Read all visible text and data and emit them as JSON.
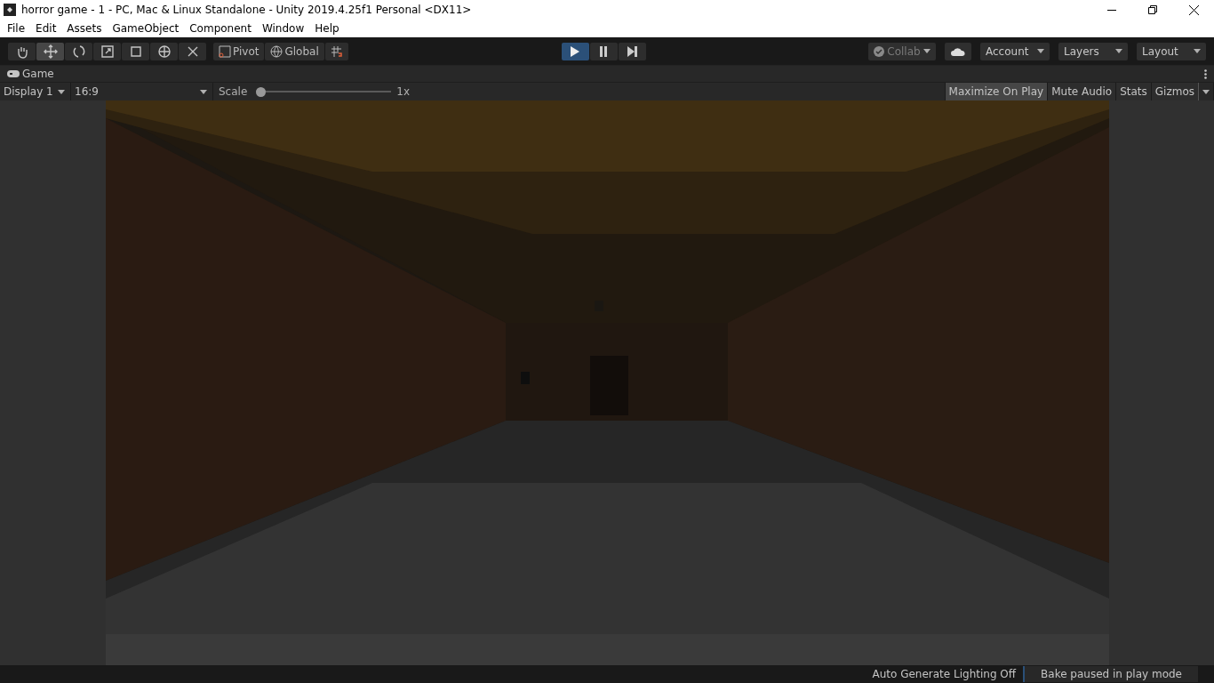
{
  "window": {
    "title": "horror game - 1 - PC, Mac & Linux Standalone - Unity 2019.4.25f1 Personal <DX11>"
  },
  "menu": [
    "File",
    "Edit",
    "Assets",
    "GameObject",
    "Component",
    "Window",
    "Help"
  ],
  "tools": [
    {
      "kind": "hand",
      "selected": false
    },
    {
      "kind": "move",
      "selected": true
    },
    {
      "kind": "rotate",
      "selected": false
    },
    {
      "kind": "scale",
      "selected": false
    },
    {
      "kind": "rect",
      "selected": false
    },
    {
      "kind": "transform",
      "selected": false
    },
    {
      "kind": "custom",
      "selected": false
    }
  ],
  "handles": [
    {
      "kind": "pivot",
      "label": "Pivot"
    },
    {
      "kind": "global",
      "label": "Global"
    },
    {
      "kind": "snap"
    }
  ],
  "playback": [
    {
      "kind": "play",
      "on": true
    },
    {
      "kind": "pause",
      "on": false
    },
    {
      "kind": "step",
      "on": false
    }
  ],
  "right_toolbar": {
    "collab": "Collab",
    "account": "Account",
    "layers": "Layers",
    "layout": "Layout"
  },
  "game_tab": {
    "label": "Game"
  },
  "game_toolbar": {
    "display": "Display 1",
    "aspect": "16:9",
    "scale_label": "Scale",
    "scale": {
      "level": 0.0
    },
    "scale_value": "1x",
    "toggles": [
      {
        "label": "Maximize On Play",
        "on": true
      },
      {
        "label": "Mute Audio",
        "on": false
      },
      {
        "label": "Stats",
        "on": false
      },
      {
        "label": "Gizmos",
        "on": false
      }
    ]
  },
  "status_bar": {
    "lighting": "Auto Generate Lighting Off",
    "bake": "Bake paused in play mode"
  }
}
